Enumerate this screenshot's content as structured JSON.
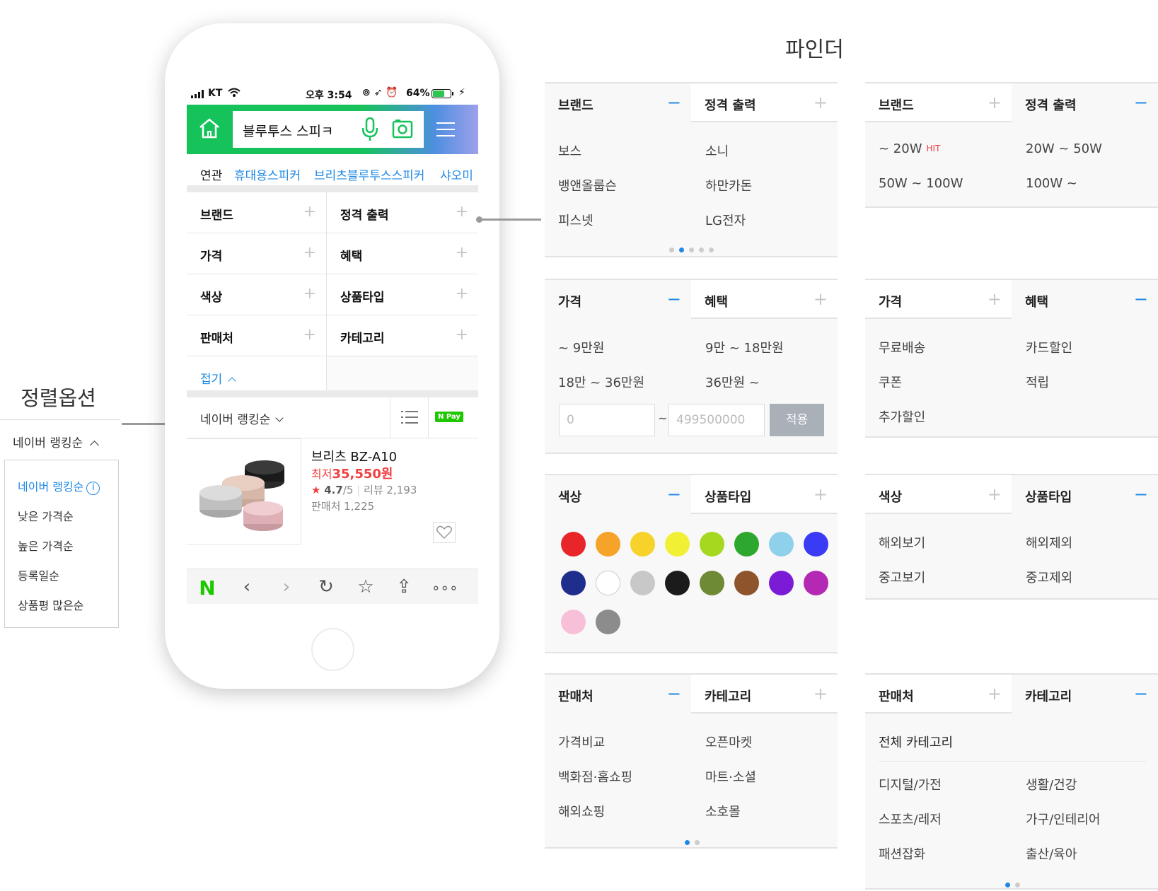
{
  "sort": {
    "title": "정렬옵션",
    "current": "네이버 랭킹순",
    "options": [
      "네이버 랭킹순",
      "낮은 가격순",
      "높은 가격순",
      "등록일순",
      "상품평 많은순"
    ]
  },
  "phone": {
    "status": {
      "carrier": "KT",
      "time": "오후 3:54",
      "battery": "64%"
    },
    "search": {
      "query": "블루투스 스피ㅋ"
    },
    "related": {
      "label": "연관",
      "items": [
        "휴대용스피커",
        "브리츠블루투스스피커",
        "샤오미"
      ]
    },
    "filters": [
      "브랜드",
      "정격 출력",
      "가격",
      "혜택",
      "색상",
      "상품타입",
      "판매처",
      "카테고리"
    ],
    "fold_label": "접기",
    "sort_label": "네이버 랭킹순",
    "npay": "N Pay",
    "product": {
      "name": "브리츠 BZ-A10",
      "price_prefix": "최저",
      "price": "35,550원",
      "rating": "4.7",
      "rating_max": "/5",
      "reviews": "리뷰 2,193",
      "sellers": "판매처 1,225"
    }
  },
  "finder": {
    "title": "파인더",
    "brand": {
      "label": "브랜드",
      "options": [
        "보스",
        "소니",
        "뱅앤올룹슨",
        "하만카돈",
        "피스넷",
        "LG전자"
      ]
    },
    "output": {
      "label": "정격 출력",
      "options": [
        "~ 20W",
        "20W ~ 50W",
        "50W ~ 100W",
        "100W ~"
      ],
      "hit": "HIT"
    },
    "price": {
      "label": "가격",
      "options": [
        "~ 9만원",
        "9만 ~ 18만원",
        "18만 ~ 36만원",
        "36만원 ~"
      ],
      "min_placeholder": "0",
      "tilde": "~",
      "max_placeholder": "499500000",
      "apply": "적용"
    },
    "benefit": {
      "label": "혜택",
      "options": [
        "무료배송",
        "카드할인",
        "쿠폰",
        "적립",
        "추가할인"
      ]
    },
    "color": {
      "label": "색상",
      "swatches": [
        "#e8262a",
        "#f5a329",
        "#f6d22a",
        "#f1f035",
        "#a5d81e",
        "#2da72d",
        "#8fd0ea",
        "#3b3bf5",
        "#1f2e8c",
        "#ffffff",
        "#c8c8c8",
        "#1b1b1b",
        "#6e8a34",
        "#8e542c",
        "#7b1bd6",
        "#b428b4",
        "#f8c0d8",
        "#8c8c8c"
      ]
    },
    "type": {
      "label": "상품타입",
      "options": [
        "해외보기",
        "해외제외",
        "중고보기",
        "중고제외"
      ]
    },
    "seller": {
      "label": "판매처",
      "options": [
        "가격비교",
        "오픈마켓",
        "백화점·홈쇼핑",
        "마트·소셜",
        "해외쇼핑",
        "소호몰"
      ]
    },
    "category": {
      "label": "카테고리",
      "all": "전체 카테고리",
      "options": [
        "디지털/가전",
        "생활/건강",
        "스포츠/레저",
        "가구/인테리어",
        "패션잡화",
        "출산/육아"
      ]
    },
    "minus": "−",
    "plus": "+"
  }
}
